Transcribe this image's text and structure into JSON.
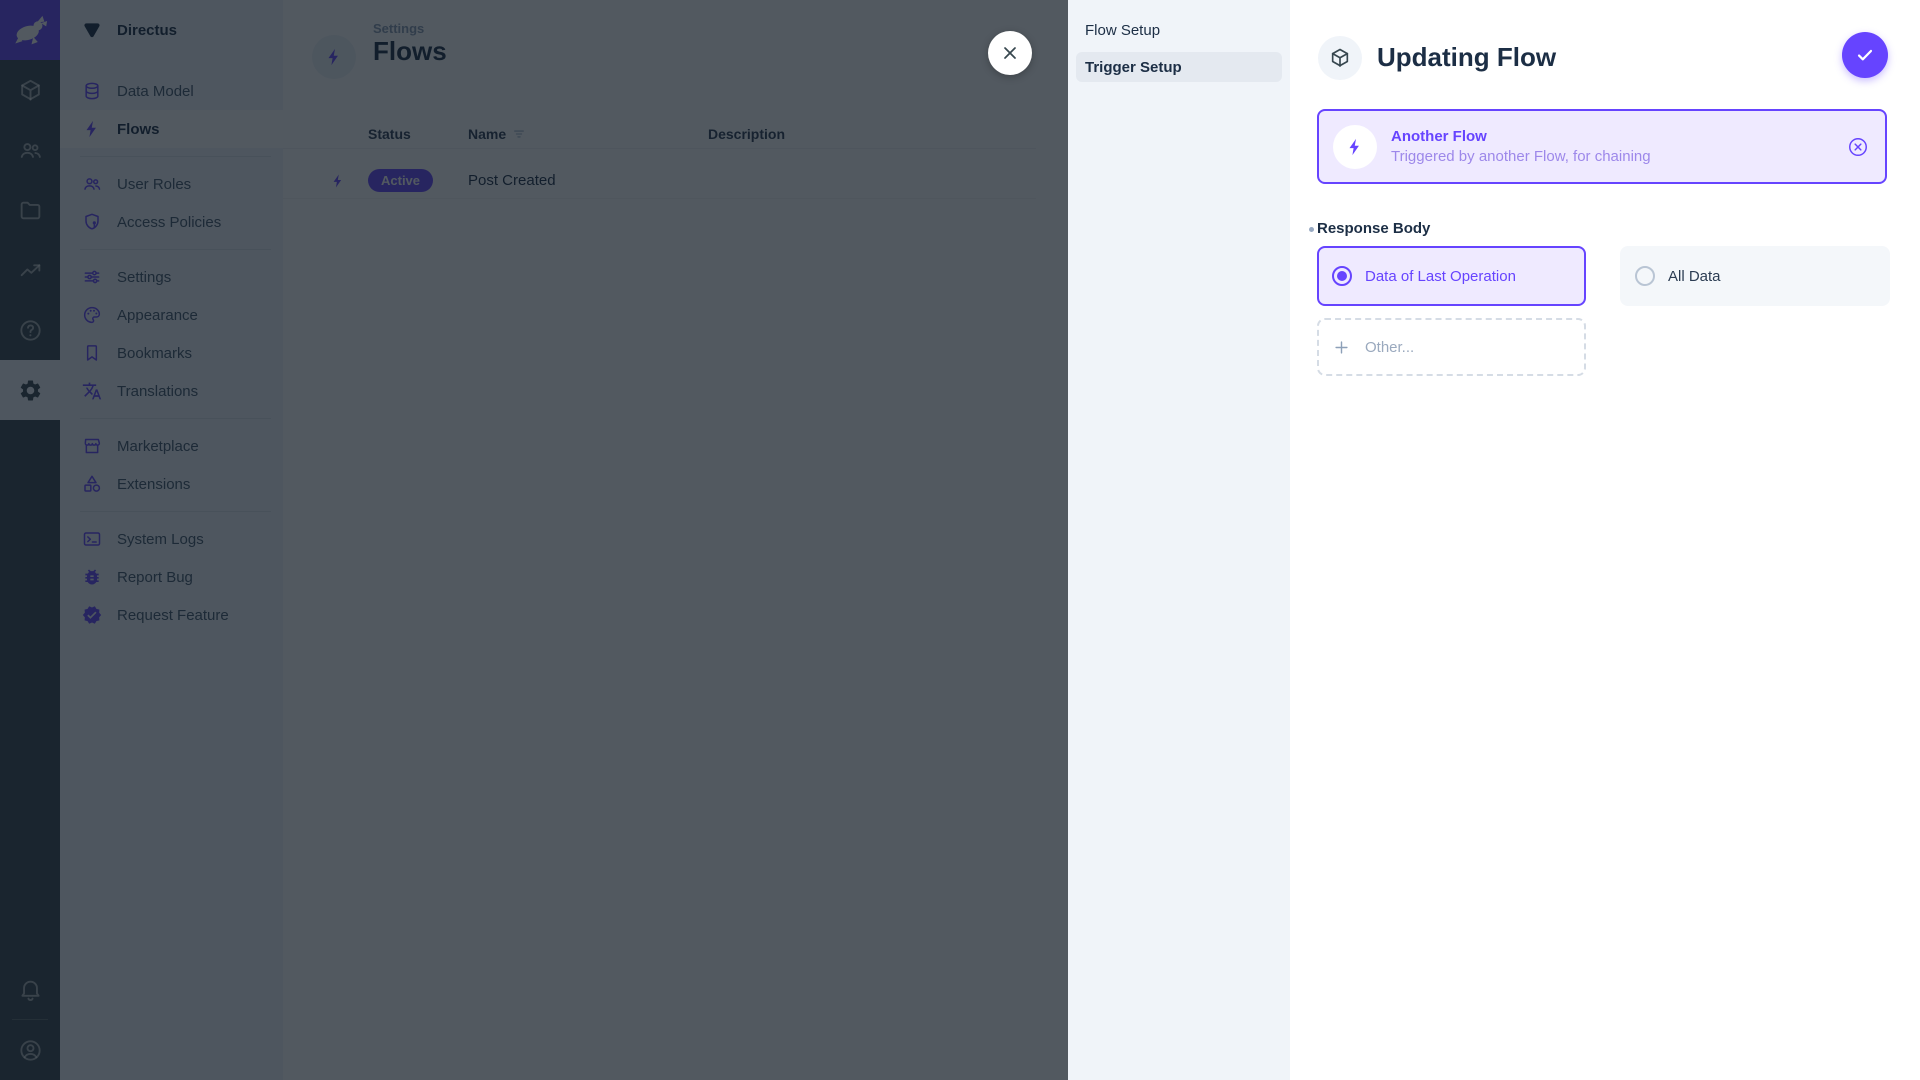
{
  "app": {
    "accent_color": "#6644FF",
    "overlay_color": "rgba(15,25,35,0.72)"
  },
  "module_bar": {
    "logo_icon": "directus-rabbit-icon",
    "modules": [
      {
        "name": "content",
        "icon": "box-icon",
        "active": false
      },
      {
        "name": "users",
        "icon": "people-icon",
        "active": false
      },
      {
        "name": "files",
        "icon": "folder-icon",
        "active": false
      },
      {
        "name": "insights",
        "icon": "activity-icon",
        "active": false
      },
      {
        "name": "docs",
        "icon": "help-icon",
        "active": false
      },
      {
        "name": "settings",
        "icon": "gear-icon",
        "active": true
      }
    ],
    "bottom": [
      {
        "name": "notifications",
        "icon": "bell-icon"
      },
      {
        "name": "user-menu",
        "icon": "avatar-icon"
      }
    ]
  },
  "sidebar": {
    "project_name": "Directus",
    "project_icon": "project-wedge-icon",
    "groups": [
      {
        "items": [
          {
            "label": "Data Model",
            "icon": "database-icon",
            "active": false
          },
          {
            "label": "Flows",
            "icon": "bolt-icon",
            "active": true
          }
        ]
      },
      {
        "items": [
          {
            "label": "User Roles",
            "icon": "people-icon",
            "active": false
          },
          {
            "label": "Access Policies",
            "icon": "shield-icon",
            "active": false
          }
        ]
      },
      {
        "items": [
          {
            "label": "Settings",
            "icon": "sliders-icon",
            "active": false
          },
          {
            "label": "Appearance",
            "icon": "palette-icon",
            "active": false
          },
          {
            "label": "Bookmarks",
            "icon": "bookmark-icon",
            "active": false
          },
          {
            "label": "Translations",
            "icon": "translate-icon",
            "active": false
          }
        ]
      },
      {
        "items": [
          {
            "label": "Marketplace",
            "icon": "storefront-icon",
            "active": false
          },
          {
            "label": "Extensions",
            "icon": "category-icon",
            "active": false
          }
        ]
      },
      {
        "items": [
          {
            "label": "System Logs",
            "icon": "terminal-icon",
            "active": false
          },
          {
            "label": "Report Bug",
            "icon": "bug-icon",
            "active": false
          },
          {
            "label": "Request Feature",
            "icon": "feature-icon",
            "active": false
          }
        ]
      }
    ]
  },
  "main": {
    "breadcrumb": "Settings",
    "title": "Flows",
    "table": {
      "columns": [
        "Status",
        "Name",
        "Description"
      ],
      "rows": [
        {
          "status": "Active",
          "name": "Post Created",
          "description": ""
        }
      ]
    }
  },
  "drawer": {
    "nav": [
      {
        "label": "Flow Setup",
        "active": false
      },
      {
        "label": "Trigger Setup",
        "active": true
      }
    ],
    "title": "Updating Flow",
    "trigger_card": {
      "title": "Another Flow",
      "subtitle": "Triggered by another Flow, for chaining"
    },
    "field": {
      "label": "Response Body",
      "required": true,
      "options": [
        {
          "label": "Data of Last Operation",
          "selected": true
        },
        {
          "label": "All Data",
          "selected": false
        }
      ],
      "other_label": "Other..."
    }
  }
}
